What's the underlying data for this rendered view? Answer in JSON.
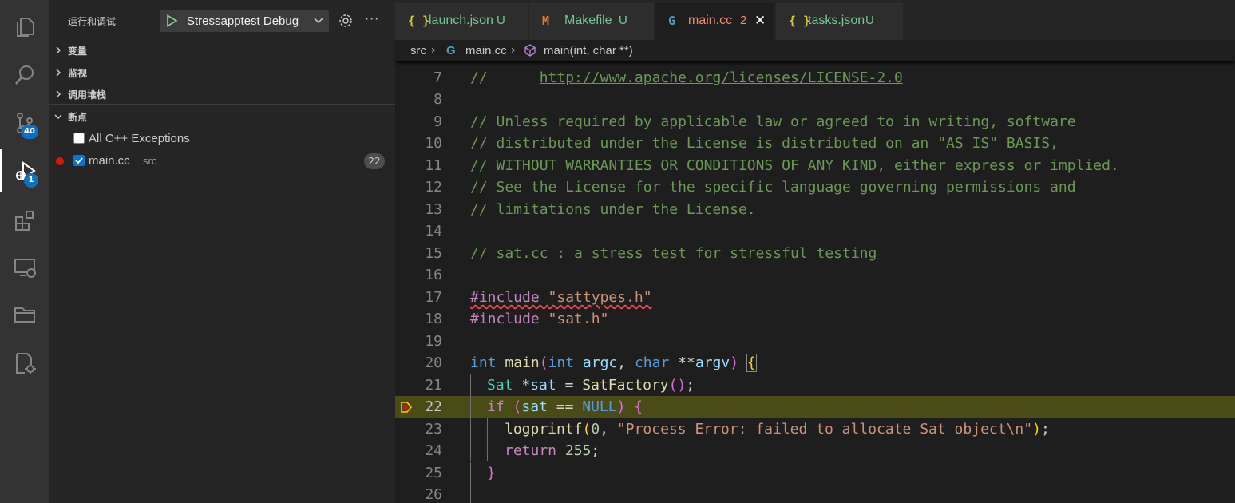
{
  "activity_bar": {
    "items": [
      {
        "name": "explorer",
        "icon": "files-icon"
      },
      {
        "name": "search",
        "icon": "search-icon"
      },
      {
        "name": "source-control",
        "icon": "source-control-icon",
        "badge": "40"
      },
      {
        "name": "run-and-debug",
        "icon": "debug-icon",
        "badge": "1",
        "active": true
      },
      {
        "name": "extensions",
        "icon": "extensions-icon"
      },
      {
        "name": "remote-explorer",
        "icon": "remote-explorer-icon"
      },
      {
        "name": "folders",
        "icon": "folder-icon"
      },
      {
        "name": "cmake",
        "icon": "cmake-icon"
      }
    ]
  },
  "sidebar": {
    "title": "运行和调试",
    "config_name": "Stressapptest Debug",
    "sections": {
      "variables": "变量",
      "watch": "监视",
      "call_stack": "调用堆栈",
      "breakpoints": "断点"
    },
    "breakpoints": [
      {
        "label": "All C++ Exceptions",
        "checked": false
      },
      {
        "label": "main.cc",
        "path": "src",
        "line": "22",
        "checked": true
      }
    ]
  },
  "tabs": [
    {
      "icon": "{ }",
      "name": "launch.json",
      "status": "U",
      "active": false
    },
    {
      "icon": "M",
      "name": "Makefile",
      "status": "U",
      "active": false
    },
    {
      "icon": "G",
      "name": "main.cc",
      "status": "2",
      "active": true
    },
    {
      "icon": "{ }",
      "name": "tasks.json",
      "status": "U",
      "active": false
    }
  ],
  "breadcrumb": {
    "folder": "src",
    "file": "main.cc",
    "symbol": "main(int, char **)"
  },
  "code": {
    "line_numbers": [
      "7",
      "8",
      "9",
      "10",
      "11",
      "12",
      "13",
      "14",
      "15",
      "16",
      "17",
      "18",
      "19",
      "20",
      "21",
      "22",
      "23",
      "24",
      "25",
      "26"
    ],
    "l7_comment": "//      ",
    "l7_url": "http://www.apache.org/licenses/LICENSE-2.0",
    "l9": "// Unless required by applicable law or agreed to in writing, software",
    "l10": "// distributed under the License is distributed on an \"AS IS\" BASIS,",
    "l11": "// WITHOUT WARRANTIES OR CONDITIONS OF ANY KIND, either express or implied.",
    "l12": "// See the License for the specific language governing permissions and",
    "l13": "// limitations under the License.",
    "l15": "// sat.cc : a stress test for stressful testing",
    "l17_directive": "#include ",
    "l17_file": "\"sattypes.h\"",
    "l18_directive": "#include ",
    "l18_file": "\"sat.h\""
  },
  "colors": {
    "accent": "#0e70c0",
    "current_line": "#4b4b18",
    "breakpoint": "#e51400",
    "tab_modified": "#e2c08d",
    "tab_error": "#f48771",
    "untracked": "#73c991"
  }
}
